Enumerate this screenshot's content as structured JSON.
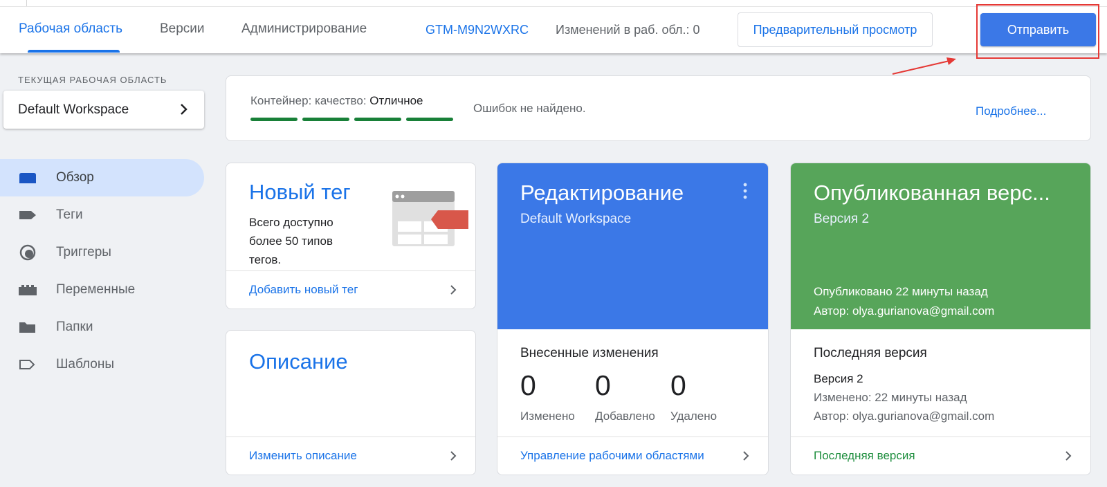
{
  "topbar": {
    "tabs": [
      "Рабочая область",
      "Версии",
      "Администрирование"
    ],
    "container_id": "GTM-M9N2WXRC",
    "changes": "Изменений в раб. обл.: 0",
    "preview_label": "Предварительный просмотр",
    "submit_label": "Отправить"
  },
  "sidebar": {
    "workspace_heading": "ТЕКУЩАЯ РАБОЧАЯ ОБЛАСТЬ",
    "workspace_name": "Default Workspace",
    "items": [
      {
        "label": "Обзор",
        "icon": "overview-icon",
        "active": true
      },
      {
        "label": "Теги",
        "icon": "tag-icon"
      },
      {
        "label": "Триггеры",
        "icon": "trigger-icon"
      },
      {
        "label": "Переменные",
        "icon": "variables-icon"
      },
      {
        "label": "Папки",
        "icon": "folder-icon"
      },
      {
        "label": "Шаблоны",
        "icon": "template-icon"
      }
    ]
  },
  "quality": {
    "label": "Контейнер: качество:",
    "value": "Отличное",
    "errors": "Ошибок не найдено.",
    "more_link": "Подробнее..."
  },
  "cards": {
    "new_tag": {
      "title": "Новый тег",
      "description": "Всего доступно более 50 типов тегов.",
      "link": "Добавить новый тег"
    },
    "description": {
      "title": "Описание",
      "link": "Изменить описание"
    },
    "editing": {
      "title": "Редактирование",
      "subtitle": "Default Workspace",
      "section_title": "Внесенные изменения",
      "stats": [
        {
          "value": "0",
          "label": "Изменено"
        },
        {
          "value": "0",
          "label": "Добавлено"
        },
        {
          "value": "0",
          "label": "Удалено"
        }
      ],
      "link": "Управление рабочими областями"
    },
    "published": {
      "title": "Опубликованная верс...",
      "subtitle": "Версия 2",
      "published_ago": "Опубликовано 22 минуты назад",
      "author": "Автор: olya.gurianova@gmail.com",
      "section_title": "Последняя версия",
      "version": "Версия 2",
      "modified": "Изменено: 22 минуты назад",
      "version_author": "Автор: olya.gurianova@gmail.com",
      "link": "Последняя версия"
    }
  },
  "colors": {
    "accent": "#1a73e8",
    "submit": "#3b78e7",
    "editing_card": "#3b78e7",
    "published_card": "#57a55a",
    "quality_bar": "#188038",
    "annotation": "#e53935"
  }
}
